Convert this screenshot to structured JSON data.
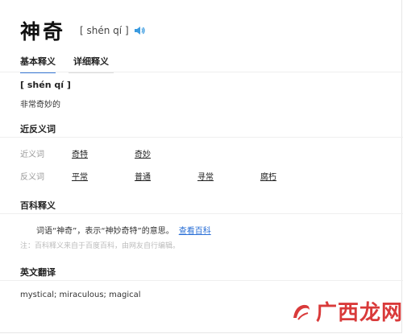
{
  "header": {
    "word": "神奇",
    "pinyin": "[ shén qí ]",
    "speaker_icon": "speaker-icon"
  },
  "tabs": [
    {
      "label": "基本释义",
      "active": true
    },
    {
      "label": "详细释义",
      "active": false
    }
  ],
  "basic": {
    "pinyin": "[ shén qí ]",
    "definition": "非常奇妙的"
  },
  "synonyms_antonyms": {
    "title": "近反义词",
    "synonym_label": "近义词",
    "synonyms": [
      "奇特",
      "奇妙"
    ],
    "antonym_label": "反义词",
    "antonyms": [
      "平常",
      "普通",
      "寻常",
      "腐朽"
    ]
  },
  "baike": {
    "title": "百科释义",
    "text": "词语“神奇”，表示“神妙奇特”的意思。",
    "link": "查看百科",
    "note": "注：百科释义来自于百度百科，由网友自行编辑。"
  },
  "translation": {
    "title": "英文翻译",
    "text": "mystical; miraculous; magical"
  },
  "watermark": {
    "text": "广西龙网",
    "color": "#d93a3a"
  },
  "colors": {
    "accent": "#3b7bd9",
    "link": "#2a6fd6"
  }
}
